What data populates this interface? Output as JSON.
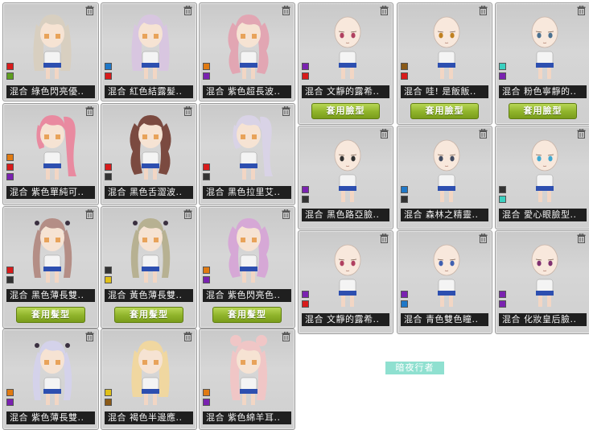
{
  "hair_cards": [
    {
      "label": "混合 綠色閃亮優..",
      "colors": [
        "#d81b1b",
        "#5f9e1f"
      ],
      "hair": "#d8cfc0",
      "style": "long",
      "button": ""
    },
    {
      "label": "混合 紅色結露髮..",
      "colors": [
        "#1f78c8",
        "#d81b1b"
      ],
      "hair": "#d8c6e0",
      "style": "long",
      "button": ""
    },
    {
      "label": "混合 紫色超長波..",
      "colors": [
        "#e07a12",
        "#7a22b0"
      ],
      "hair": "#e2a6b3",
      "style": "wavy",
      "button": ""
    },
    {
      "label": "混合 紫色單純可..",
      "colors": [
        "#e07a12",
        "#d81b1b",
        "#7a22b0"
      ],
      "hair": "#e98aa0",
      "style": "pony",
      "button": ""
    },
    {
      "label": "混合 黑色舌澀波..",
      "colors": [
        "#d81b1b",
        "#333333"
      ],
      "hair": "#7b4a40",
      "style": "wavy",
      "button": ""
    },
    {
      "label": "混合 黑色拉里艾..",
      "colors": [
        "#d81b1b",
        "#333333"
      ],
      "hair": "#d9d3e6",
      "style": "pony",
      "button": ""
    },
    {
      "label": "混合 黑色薄長雙..",
      "colors": [
        "#d81b1b",
        "#333333"
      ],
      "hair": "#b48e86",
      "style": "twin",
      "button": "套用髮型"
    },
    {
      "label": "混合 黃色薄長雙..",
      "colors": [
        "#333333",
        "#e0c018"
      ],
      "hair": "#b7b192",
      "style": "twin",
      "button": "套用髮型"
    },
    {
      "label": "混合 紫色閃亮色..",
      "colors": [
        "#e07a12",
        "#7a22b0"
      ],
      "hair": "#d6a8d6",
      "style": "wavy",
      "button": "套用髮型"
    },
    {
      "label": "混合 紫色薄長雙..",
      "colors": [
        "#e07a12",
        "#7a22b0"
      ],
      "hair": "#d4d2ea",
      "style": "twin",
      "button": ""
    },
    {
      "label": "混合 褐色半邊應..",
      "colors": [
        "#e0c018",
        "#8a5a18"
      ],
      "hair": "#f0d7a0",
      "style": "long",
      "button": ""
    },
    {
      "label": "混合 紫色綿羊耳..",
      "colors": [
        "#e07a12",
        "#7a22b0"
      ],
      "hair": "#f0c6c6",
      "style": "bun",
      "button": ""
    }
  ],
  "face_cards": [
    {
      "label": "混合 文靜的露希..",
      "colors": [
        "#7a22b0",
        "#d81b1b"
      ],
      "eye": "#b04060",
      "button": "套用臉型"
    },
    {
      "label": "混合 哇! 是飯飯..",
      "colors": [
        "#8a5a18",
        "#d81b1b"
      ],
      "eye": "#c08020",
      "button": "套用臉型"
    },
    {
      "label": "混合 粉色寧靜的..",
      "colors": [
        "#3ad0c0",
        "#7a22b0"
      ],
      "eye": "#4a7090",
      "button": "套用臉型"
    },
    {
      "label": "混合 黑色路亞臉..",
      "colors": [
        "#7a22b0",
        "#333333"
      ],
      "eye": "#303030",
      "button": ""
    },
    {
      "label": "混合 森林之精靈..",
      "colors": [
        "#1f78c8",
        "#333333"
      ],
      "eye": "#404a60",
      "button": ""
    },
    {
      "label": "混合 愛心眼臉型..",
      "colors": [
        "#333333",
        "#3ad0c0"
      ],
      "eye": "#40a8d0",
      "button": ""
    },
    {
      "label": "混合 文靜的露希..",
      "colors": [
        "#7a22b0",
        "#d81b1b"
      ],
      "eye": "#b04060",
      "button": ""
    },
    {
      "label": "混合 青色雙色瞳..",
      "colors": [
        "#7a22b0",
        "#1f78c8"
      ],
      "eye": "#4060b0",
      "button": ""
    },
    {
      "label": "混合 化妝皇后臉..",
      "colors": [
        "#7a22b0",
        "#7a22b0"
      ],
      "eye": "#803070",
      "button": ""
    }
  ],
  "badge": {
    "text": "暗夜行者"
  },
  "icons": {
    "trash": "trash-icon"
  }
}
